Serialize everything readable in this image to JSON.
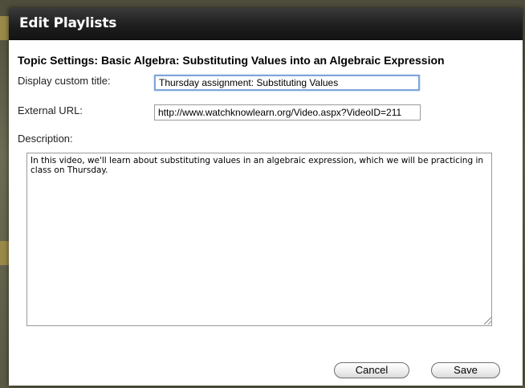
{
  "dialog": {
    "title": "Edit Playlists",
    "heading": "Topic Settings: Basic Algebra: Substituting Values into an Algebraic Expression",
    "fields": {
      "custom_title_label": "Display custom title:",
      "custom_title_value": "Thursday assignment: Substituting Values",
      "external_url_label": "External URL:",
      "external_url_value": "http://www.watchknowlearn.org/Video.aspx?VideoID=211",
      "description_label": "Description:",
      "description_value": "In this video, we'll learn about substituting values in an algebraic expression, which we will be practicing in class on Thursday."
    },
    "buttons": {
      "cancel": "Cancel",
      "save": "Save"
    }
  }
}
